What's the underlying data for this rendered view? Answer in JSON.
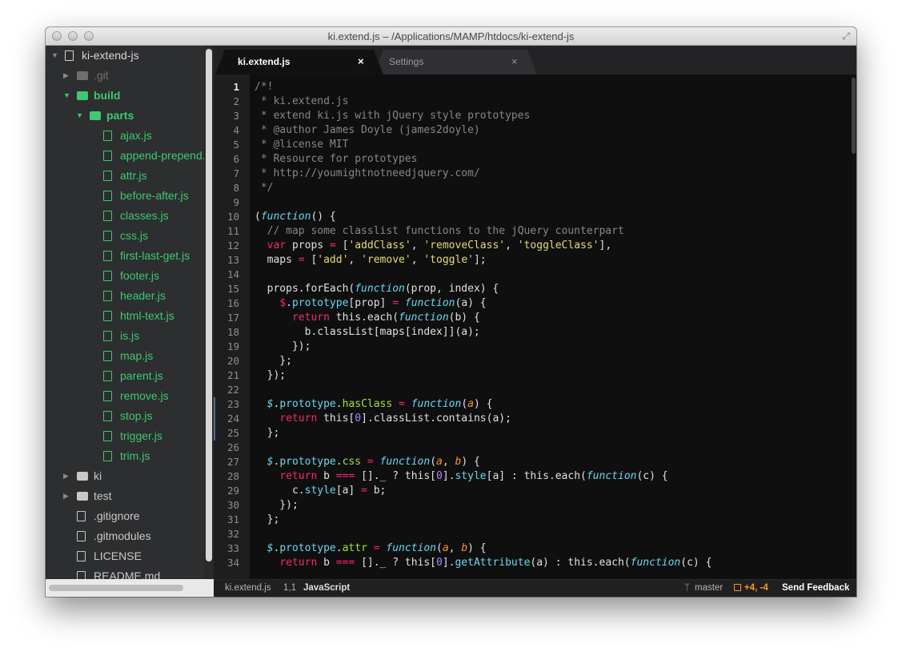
{
  "window": {
    "title": "ki.extend.js – /Applications/MAMP/htdocs/ki-extend-js"
  },
  "colors": {
    "accent_green": "#3ec970",
    "editor_bg": "#0f0f0f",
    "sidebar_bg": "#2d2e30",
    "git_added": "#fd971f"
  },
  "sidebar": {
    "items": [
      {
        "label": "ki-extend-js",
        "depth": 0,
        "kind": "repo",
        "state": "expanded",
        "color": "#d6d6d6",
        "icon": "repo-icon"
      },
      {
        "label": ".git",
        "depth": 1,
        "kind": "folder",
        "state": "collapsed",
        "color": "#6f6f6f",
        "icon": "folder-icon"
      },
      {
        "label": "build",
        "depth": 1,
        "kind": "folder",
        "state": "expanded",
        "color": "#3ec970",
        "icon": "folder-icon"
      },
      {
        "label": "parts",
        "depth": 2,
        "kind": "folder",
        "state": "expanded",
        "color": "#3ec970",
        "icon": "folder-icon"
      },
      {
        "label": "ajax.js",
        "depth": 3,
        "kind": "file",
        "color": "#3ec970",
        "icon": "file-icon"
      },
      {
        "label": "append-prepend.js",
        "depth": 3,
        "kind": "file",
        "color": "#3ec970",
        "icon": "file-icon"
      },
      {
        "label": "attr.js",
        "depth": 3,
        "kind": "file",
        "color": "#3ec970",
        "icon": "file-icon"
      },
      {
        "label": "before-after.js",
        "depth": 3,
        "kind": "file",
        "color": "#3ec970",
        "icon": "file-icon"
      },
      {
        "label": "classes.js",
        "depth": 3,
        "kind": "file",
        "color": "#3ec970",
        "icon": "file-icon"
      },
      {
        "label": "css.js",
        "depth": 3,
        "kind": "file",
        "color": "#3ec970",
        "icon": "file-icon"
      },
      {
        "label": "first-last-get.js",
        "depth": 3,
        "kind": "file",
        "color": "#3ec970",
        "icon": "file-icon"
      },
      {
        "label": "footer.js",
        "depth": 3,
        "kind": "file",
        "color": "#3ec970",
        "icon": "file-icon"
      },
      {
        "label": "header.js",
        "depth": 3,
        "kind": "file",
        "color": "#3ec970",
        "icon": "file-icon"
      },
      {
        "label": "html-text.js",
        "depth": 3,
        "kind": "file",
        "color": "#3ec970",
        "icon": "file-icon"
      },
      {
        "label": "is.js",
        "depth": 3,
        "kind": "file",
        "color": "#3ec970",
        "icon": "file-icon"
      },
      {
        "label": "map.js",
        "depth": 3,
        "kind": "file",
        "color": "#3ec970",
        "icon": "file-icon"
      },
      {
        "label": "parent.js",
        "depth": 3,
        "kind": "file",
        "color": "#3ec970",
        "icon": "file-icon"
      },
      {
        "label": "remove.js",
        "depth": 3,
        "kind": "file",
        "color": "#3ec970",
        "icon": "file-icon"
      },
      {
        "label": "stop.js",
        "depth": 3,
        "kind": "file",
        "color": "#3ec970",
        "icon": "file-icon"
      },
      {
        "label": "trigger.js",
        "depth": 3,
        "kind": "file",
        "color": "#3ec970",
        "icon": "file-icon"
      },
      {
        "label": "trim.js",
        "depth": 3,
        "kind": "file",
        "color": "#3ec970",
        "icon": "file-icon"
      },
      {
        "label": "ki",
        "depth": 1,
        "kind": "folder",
        "state": "collapsed",
        "color": "#c8c8c8",
        "icon": "folder-icon"
      },
      {
        "label": "test",
        "depth": 1,
        "kind": "folder",
        "state": "collapsed",
        "color": "#c8c8c8",
        "icon": "folder-icon"
      },
      {
        "label": ".gitignore",
        "depth": 1,
        "kind": "file",
        "color": "#c8c8c8",
        "icon": "file-icon"
      },
      {
        "label": ".gitmodules",
        "depth": 1,
        "kind": "file",
        "color": "#c8c8c8",
        "icon": "file-icon"
      },
      {
        "label": "LICENSE",
        "depth": 1,
        "kind": "file",
        "color": "#c8c8c8",
        "icon": "file-icon"
      },
      {
        "label": "README.md",
        "depth": 1,
        "kind": "file",
        "color": "#c8c8c8",
        "icon": "book-icon"
      }
    ]
  },
  "tabs": [
    {
      "label": "ki.extend.js",
      "active": true,
      "close": "×"
    },
    {
      "label": "Settings",
      "active": false,
      "close": "×"
    }
  ],
  "editor": {
    "current_line": 1,
    "modified_lines": [
      23,
      24,
      25
    ],
    "lines": [
      {
        "n": "1",
        "t": [
          [
            "c-com",
            "/*!"
          ]
        ]
      },
      {
        "n": "2",
        "t": [
          [
            "c-com",
            " * ki.extend.js"
          ]
        ]
      },
      {
        "n": "3",
        "t": [
          [
            "c-com",
            " * extend ki.js with jQuery style prototypes"
          ]
        ]
      },
      {
        "n": "4",
        "t": [
          [
            "c-com",
            " * @author James Doyle (james2doyle)"
          ]
        ]
      },
      {
        "n": "5",
        "t": [
          [
            "c-com",
            " * @license MIT"
          ]
        ]
      },
      {
        "n": "6",
        "t": [
          [
            "c-com",
            " * Resource for prototypes"
          ]
        ]
      },
      {
        "n": "7",
        "t": [
          [
            "c-com",
            " * http://youmightnotneedjquery.com/"
          ]
        ]
      },
      {
        "n": "8",
        "t": [
          [
            "c-com",
            " */"
          ]
        ]
      },
      {
        "n": "9",
        "t": []
      },
      {
        "n": "10",
        "t": [
          [
            "c-plain",
            "("
          ],
          [
            "c-fn",
            "function"
          ],
          [
            "c-plain",
            "() {"
          ]
        ]
      },
      {
        "n": "11",
        "t": [
          [
            "c-com",
            "  // map some classlist functions to the jQuery counterpart"
          ]
        ]
      },
      {
        "n": "12",
        "t": [
          [
            "c-plain",
            "  "
          ],
          [
            "c-kw",
            "var"
          ],
          [
            "c-plain",
            " props "
          ],
          [
            "c-kw",
            "="
          ],
          [
            "c-plain",
            " ["
          ],
          [
            "c-str",
            "'addClass'"
          ],
          [
            "c-plain",
            ", "
          ],
          [
            "c-str",
            "'removeClass'"
          ],
          [
            "c-plain",
            ", "
          ],
          [
            "c-str",
            "'toggleClass'"
          ],
          [
            "c-plain",
            "],"
          ]
        ]
      },
      {
        "n": "13",
        "t": [
          [
            "c-plain",
            "  maps "
          ],
          [
            "c-kw",
            "="
          ],
          [
            "c-plain",
            " ["
          ],
          [
            "c-str",
            "'add'"
          ],
          [
            "c-plain",
            ", "
          ],
          [
            "c-str",
            "'remove'"
          ],
          [
            "c-plain",
            ", "
          ],
          [
            "c-str",
            "'toggle'"
          ],
          [
            "c-plain",
            "];"
          ]
        ]
      },
      {
        "n": "14",
        "t": []
      },
      {
        "n": "15",
        "t": [
          [
            "c-plain",
            "  props.forEach("
          ],
          [
            "c-fn",
            "function"
          ],
          [
            "c-plain",
            "(prop, index) {"
          ]
        ]
      },
      {
        "n": "16",
        "t": [
          [
            "c-plain",
            "    "
          ],
          [
            "c-kw",
            "$"
          ],
          [
            "c-plain",
            "."
          ],
          [
            "c-prop",
            "prototype"
          ],
          [
            "c-plain",
            "[prop] "
          ],
          [
            "c-kw",
            "="
          ],
          [
            "c-plain",
            " "
          ],
          [
            "c-fn",
            "function"
          ],
          [
            "c-plain",
            "(a) {"
          ]
        ]
      },
      {
        "n": "17",
        "t": [
          [
            "c-plain",
            "      "
          ],
          [
            "c-kw",
            "return"
          ],
          [
            "c-plain",
            " this.each("
          ],
          [
            "c-fn",
            "function"
          ],
          [
            "c-plain",
            "(b) {"
          ]
        ]
      },
      {
        "n": "18",
        "t": [
          [
            "c-plain",
            "        b.classList[maps[index]](a);"
          ]
        ]
      },
      {
        "n": "19",
        "t": [
          [
            "c-plain",
            "      });"
          ]
        ]
      },
      {
        "n": "20",
        "t": [
          [
            "c-plain",
            "    };"
          ]
        ]
      },
      {
        "n": "21",
        "t": [
          [
            "c-plain",
            "  });"
          ]
        ]
      },
      {
        "n": "22",
        "t": []
      },
      {
        "n": "23",
        "t": [
          [
            "c-plain",
            "  "
          ],
          [
            "c-dollar",
            "$"
          ],
          [
            "c-plain",
            "."
          ],
          [
            "c-prop",
            "prototype"
          ],
          [
            "c-plain",
            "."
          ],
          [
            "c-name",
            "hasClass"
          ],
          [
            "c-plain",
            " "
          ],
          [
            "c-kw",
            "="
          ],
          [
            "c-plain",
            " "
          ],
          [
            "c-fn",
            "function"
          ],
          [
            "c-plain",
            "("
          ],
          [
            "c-param",
            "a"
          ],
          [
            "c-plain",
            ") {"
          ]
        ]
      },
      {
        "n": "24",
        "t": [
          [
            "c-plain",
            "    "
          ],
          [
            "c-kw",
            "return"
          ],
          [
            "c-plain",
            " this["
          ],
          [
            "c-num",
            "0"
          ],
          [
            "c-plain",
            "].classList.contains(a);"
          ]
        ]
      },
      {
        "n": "25",
        "t": [
          [
            "c-plain",
            "  };"
          ]
        ]
      },
      {
        "n": "26",
        "t": []
      },
      {
        "n": "27",
        "t": [
          [
            "c-plain",
            "  "
          ],
          [
            "c-dollar",
            "$"
          ],
          [
            "c-plain",
            "."
          ],
          [
            "c-prop",
            "prototype"
          ],
          [
            "c-plain",
            "."
          ],
          [
            "c-name",
            "css"
          ],
          [
            "c-plain",
            " "
          ],
          [
            "c-kw",
            "="
          ],
          [
            "c-plain",
            " "
          ],
          [
            "c-fn",
            "function"
          ],
          [
            "c-plain",
            "("
          ],
          [
            "c-param",
            "a"
          ],
          [
            "c-plain",
            ", "
          ],
          [
            "c-param",
            "b"
          ],
          [
            "c-plain",
            ") {"
          ]
        ]
      },
      {
        "n": "28",
        "t": [
          [
            "c-plain",
            "    "
          ],
          [
            "c-kw",
            "return"
          ],
          [
            "c-plain",
            " b "
          ],
          [
            "c-kw",
            "==="
          ],
          [
            "c-plain",
            " []._ ? this["
          ],
          [
            "c-num",
            "0"
          ],
          [
            "c-plain",
            "]."
          ],
          [
            "c-prop",
            "style"
          ],
          [
            "c-plain",
            "[a] : this.each("
          ],
          [
            "c-fn",
            "function"
          ],
          [
            "c-plain",
            "(c) {"
          ]
        ]
      },
      {
        "n": "29",
        "t": [
          [
            "c-plain",
            "      c."
          ],
          [
            "c-prop",
            "style"
          ],
          [
            "c-plain",
            "[a] "
          ],
          [
            "c-kw",
            "="
          ],
          [
            "c-plain",
            " b;"
          ]
        ]
      },
      {
        "n": "30",
        "t": [
          [
            "c-plain",
            "    });"
          ]
        ]
      },
      {
        "n": "31",
        "t": [
          [
            "c-plain",
            "  };"
          ]
        ]
      },
      {
        "n": "32",
        "t": []
      },
      {
        "n": "33",
        "t": [
          [
            "c-plain",
            "  "
          ],
          [
            "c-dollar",
            "$"
          ],
          [
            "c-plain",
            "."
          ],
          [
            "c-prop",
            "prototype"
          ],
          [
            "c-plain",
            "."
          ],
          [
            "c-name",
            "attr"
          ],
          [
            "c-plain",
            " "
          ],
          [
            "c-kw",
            "="
          ],
          [
            "c-plain",
            " "
          ],
          [
            "c-fn",
            "function"
          ],
          [
            "c-plain",
            "("
          ],
          [
            "c-param",
            "a"
          ],
          [
            "c-plain",
            ", "
          ],
          [
            "c-param",
            "b"
          ],
          [
            "c-plain",
            ") {"
          ]
        ]
      },
      {
        "n": "34",
        "t": [
          [
            "c-plain",
            "    "
          ],
          [
            "c-kw",
            "return"
          ],
          [
            "c-plain",
            " b "
          ],
          [
            "c-kw",
            "==="
          ],
          [
            "c-plain",
            " []._ ? this["
          ],
          [
            "c-num",
            "0"
          ],
          [
            "c-plain",
            "]."
          ],
          [
            "c-prop",
            "getAttribute"
          ],
          [
            "c-plain",
            "(a) : this.each("
          ],
          [
            "c-fn",
            "function"
          ],
          [
            "c-plain",
            "(c) {"
          ]
        ]
      }
    ]
  },
  "status": {
    "file": "ki.extend.js",
    "position": "1,1",
    "language": "JavaScript",
    "branch_icon": "git-branch-icon",
    "branch": "master",
    "diff_icon": "diff-icon",
    "diff": "+4, -4",
    "feedback": "Send Feedback"
  }
}
